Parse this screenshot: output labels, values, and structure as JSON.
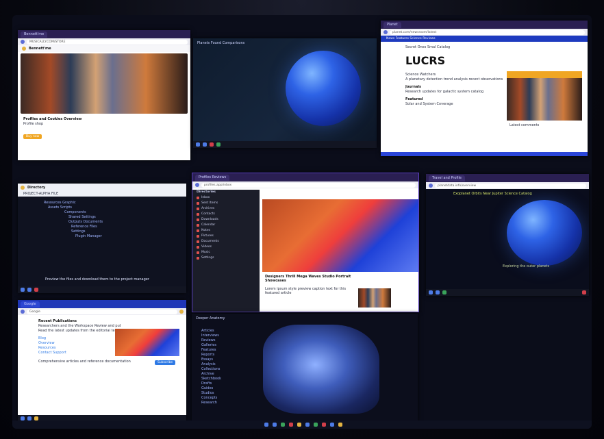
{
  "colors": {
    "accent": "#2f2466",
    "brand_blue": "#2a45d8",
    "orange": "#f0a623"
  },
  "w1": {
    "tab": "Bennett'me",
    "addr": "MUSICALLY.COM/STORE",
    "title": "Bennett'me",
    "caption": "Profiles and Cookies Overview",
    "sub": "Profile shop",
    "cta": "Buy now"
  },
  "w2": {
    "title": "Planets Found Comparisons"
  },
  "w3": {
    "addr": "planet.com/newsroom/latest",
    "nav": "News  Features  Science  Reviews",
    "header": "Secret Ones Smal Catalog",
    "big": "LUCRS",
    "p1": "Science Watchers",
    "p2": "Journals",
    "p3": "Featured",
    "p4": "Solar and System Coverage",
    "side_caption": "Latest comments",
    "lines": [
      "A planetary detection trend analysis recent observations",
      "Research updates for galactic system catalog"
    ]
  },
  "w4": {
    "title": "Directory",
    "sub": "PROJECT-ALPHA FILE",
    "tree": [
      "Resources Graphic",
      "Assets Scripts",
      "Components",
      "Shared Settings",
      "Outputs Documents",
      "Reference Files",
      "Settings",
      "Plugin Manager"
    ],
    "foot": "Preview the files and download them to the project manager"
  },
  "w5": {
    "tab": "Profiles Reviews",
    "title": "Directories",
    "side": [
      "Inbox",
      "Sent Items",
      "Archives",
      "Contacts",
      "Downloads",
      "Calendar",
      "Notes",
      "Pictures",
      "Documents",
      "Videos",
      "Music",
      "Settings"
    ],
    "headline": "Designers Thrill Mega Waves Studio Portrait Showcases",
    "body": "Lorem ipsum style preview caption text for this featured article"
  },
  "w6": {
    "tab": "Travel and Profile",
    "addr": "planetdata.info/overview",
    "headline": "Exoplanet Orbits Near Jupiter Science Catalog",
    "footer": "Exploring the outer planets"
  },
  "w7": {
    "tab": "Google",
    "search": "Google",
    "title": "Recent Publications",
    "body": [
      "Researchers and the Workspace Review and publishing tools",
      "Read the latest updates from the editorial team this week",
      "Comprehensive articles and reference documentation"
    ],
    "links": [
      "Blog",
      "Overview",
      "Resources",
      "Contact Support"
    ],
    "button": "Subscribe"
  },
  "w8": {
    "title": "Deeper Anatomy",
    "list": [
      "Articles",
      "Interviews",
      "Reviews",
      "Galleries",
      "Features",
      "Reports",
      "Essays",
      "Analysis",
      "Collections",
      "Archive",
      "Sketchbook",
      "Drafts",
      "Guides",
      "Studios",
      "Concepts",
      "Research"
    ]
  }
}
